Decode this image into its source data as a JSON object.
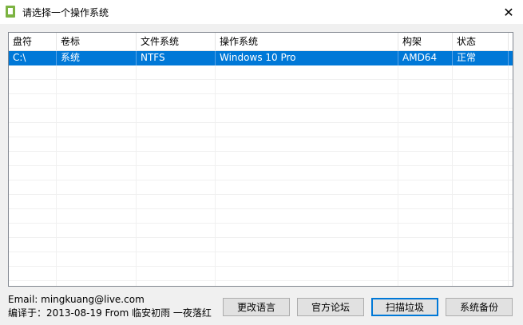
{
  "window": {
    "title": "请选择一个操作系统",
    "close_glyph": "✕",
    "icon": "app-icon"
  },
  "table": {
    "columns": [
      "盘符",
      "卷标",
      "文件系统",
      "操作系统",
      "构架",
      "状态"
    ],
    "rows": [
      {
        "drive": "C:\\",
        "label": "系统",
        "fs": "NTFS",
        "os": "Windows 10 Pro",
        "arch": "AMD64",
        "status": "正常",
        "selected": true
      }
    ]
  },
  "footer": {
    "email": "Email:  mingkuang@live.com",
    "translated": "编译于：2013-08-19 From 临安初雨 一夜落红"
  },
  "buttons": {
    "change_lang": "更改语言",
    "forum": "官方论坛",
    "scan_junk": "扫描垃圾",
    "backup": "系统备份"
  },
  "colors": {
    "selection": "#0078d7",
    "default_button_border": "#0078d7",
    "app_icon": "#7cb342"
  }
}
